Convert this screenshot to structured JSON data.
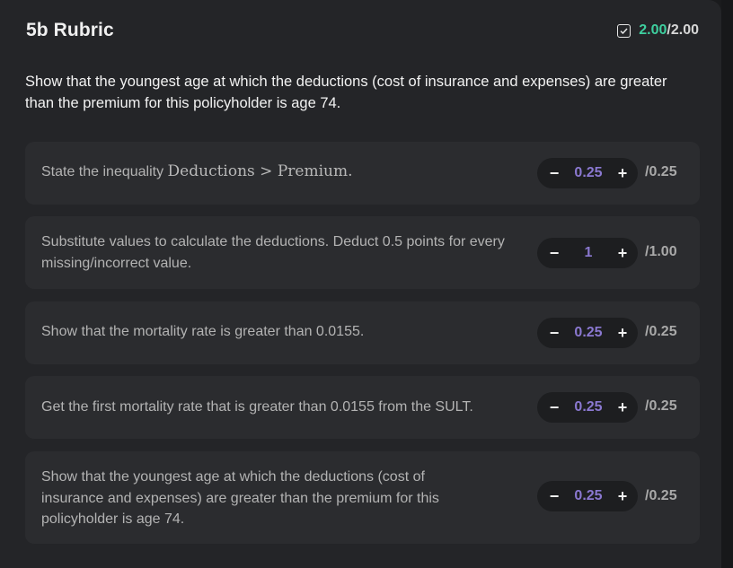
{
  "header": {
    "title": "5b Rubric",
    "score_earned": "2.00",
    "score_total": "/2.00"
  },
  "question": "Show that the youngest age at which the deductions (cost of insurance and expenses) are greater than the premium for this policyholder is age 74.",
  "items": [
    {
      "text": "State the inequality ",
      "math": "Deductions > Premium.",
      "value": "0.25",
      "max": "/0.25"
    },
    {
      "text": "Substitute values to calculate the deductions. Deduct 0.5 points for every missing/incorrect value.",
      "value": "1",
      "max": "/1.00"
    },
    {
      "text": "Show that the mortality rate is greater than 0.0155.",
      "value": "0.25",
      "max": "/0.25"
    },
    {
      "text": "Get the first mortality rate that is greater than 0.0155 from the SULT.",
      "value": "0.25",
      "max": "/0.25"
    },
    {
      "text": "Show that the youngest age at which the deductions (cost of insurance and expenses) are greater than the premium for this policyholder is age 74.",
      "value": "0.25",
      "max": "/0.25"
    }
  ],
  "controls": {
    "minus": "−",
    "plus": "+"
  },
  "colors": {
    "earned_score": "#3ecf9f",
    "stepper_value": "#8a78d0"
  }
}
